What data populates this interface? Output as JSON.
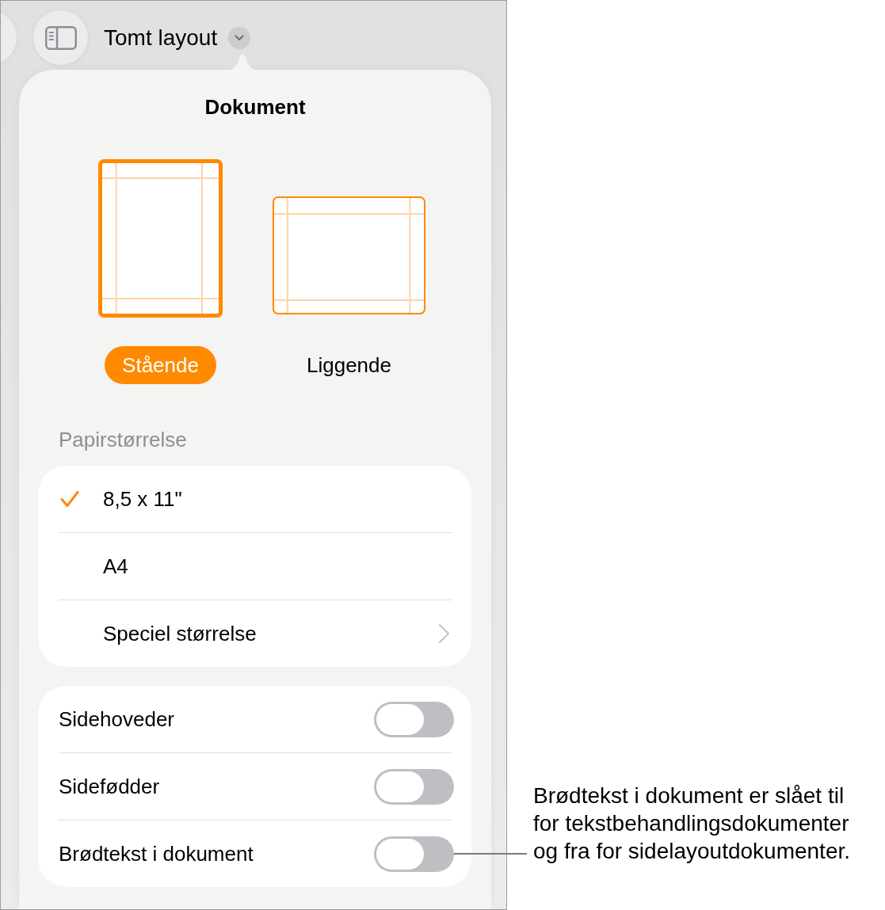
{
  "toolbar": {
    "title": "Tomt layout"
  },
  "popover": {
    "title": "Dokument",
    "orientations": [
      {
        "kind": "portrait",
        "label": "Stående",
        "selected": true
      },
      {
        "kind": "landscape",
        "label": "Liggende",
        "selected": false
      }
    ],
    "paper_size": {
      "heading": "Papirstørrelse",
      "options": [
        {
          "kind": "choice",
          "label": "8,5 x 11\"",
          "selected": true
        },
        {
          "kind": "choice",
          "label": "A4",
          "selected": false
        },
        {
          "kind": "submenu",
          "label": "Speciel størrelse",
          "selected": false
        }
      ]
    },
    "switches": [
      {
        "label": "Sidehoveder",
        "on": false
      },
      {
        "label": "Sidefødder",
        "on": false
      },
      {
        "label": "Brødtekst i dokument",
        "on": false
      }
    ]
  },
  "callout": {
    "text": "Brødtekst i dokument er slået til for tekstbehandlingsdokumenter og fra for sidelayoutdokumenter."
  }
}
